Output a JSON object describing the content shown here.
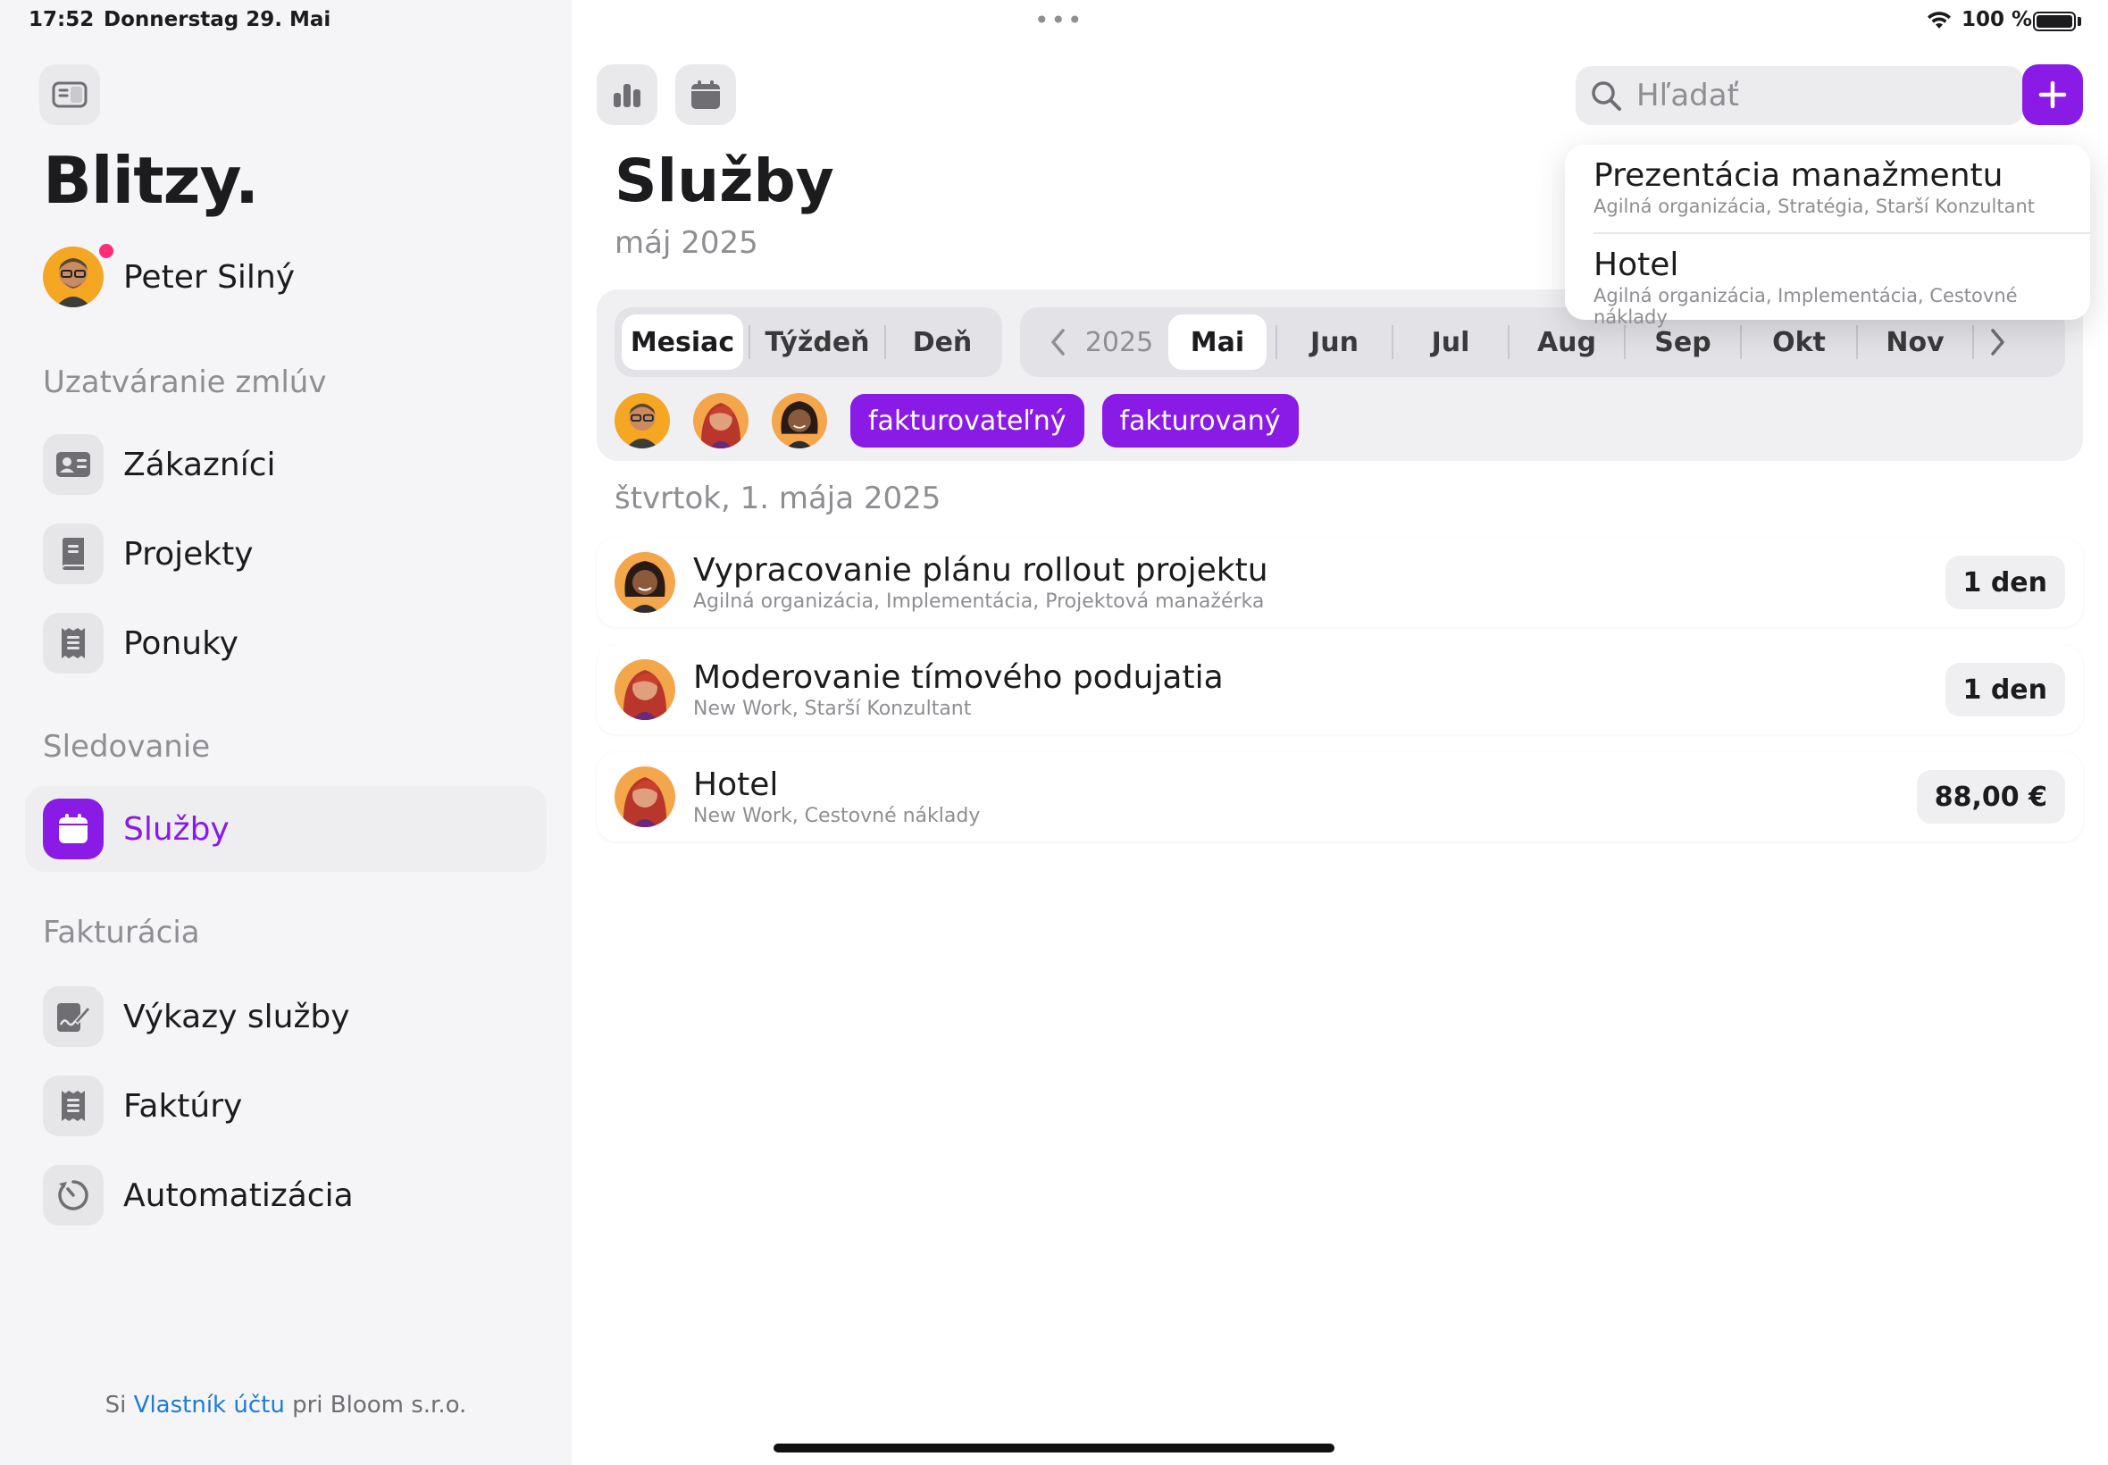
{
  "status_bar": {
    "time": "17:52",
    "date": "Donnerstag 29. Mai",
    "battery": "100 %"
  },
  "sidebar": {
    "brand": "Blitzy.",
    "user_name": "Peter Silný",
    "sections": [
      {
        "title": "Uzatváranie zmlúv",
        "items": [
          {
            "label": "Zákazníci",
            "icon": "contact-card-icon"
          },
          {
            "label": "Projekty",
            "icon": "book-icon"
          },
          {
            "label": "Ponuky",
            "icon": "document-icon"
          }
        ]
      },
      {
        "title": "Sledovanie",
        "items": [
          {
            "label": "Služby",
            "icon": "calendar-icon",
            "active": true
          }
        ]
      },
      {
        "title": "Fakturácia",
        "items": [
          {
            "label": "Výkazy služby",
            "icon": "signed-doc-icon"
          },
          {
            "label": "Faktúry",
            "icon": "receipt-icon"
          },
          {
            "label": "Automatizácia",
            "icon": "automation-icon"
          }
        ]
      }
    ],
    "footer": {
      "prefix": "Si ",
      "link": "Vlastník účtu",
      "suffix": " pri Bloom s.r.o."
    }
  },
  "toolbar": {
    "search_placeholder": "Hľadať"
  },
  "page": {
    "title": "Služby",
    "subtitle": "máj 2025"
  },
  "filters": {
    "segments": [
      "Mesiac",
      "Týždeň",
      "Deň"
    ],
    "selected_segment": "Mesiac",
    "year": "2025",
    "months": [
      "Mai",
      "Jun",
      "Jul",
      "Aug",
      "Sep",
      "Okt",
      "Nov"
    ],
    "selected_month": "Mai",
    "tags": [
      "fakturovateľný",
      "fakturovaný"
    ]
  },
  "date_header": "štvrtok, 1. mája 2025",
  "entries": [
    {
      "title": "Vypracovanie plánu rollout projektu",
      "subtitle": "Agilná organizácia, Implementácia, Projektová manažérka",
      "value": "1 den"
    },
    {
      "title": "Moderovanie tímového podujatia",
      "subtitle": "New Work, Starší Konzultant",
      "value": "1 den"
    },
    {
      "title": "Hotel",
      "subtitle": "New Work, Cestovné náklady",
      "value": "88,00 €"
    }
  ],
  "dropdown": [
    {
      "title": "Prezentácia manažmentu",
      "subtitle": "Agilná organizácia, Stratégia, Starší Konzultant"
    },
    {
      "title": "Hotel",
      "subtitle": "Agilná organizácia, Implementácia, Cestovné náklady"
    }
  ],
  "colors": {
    "accent": "#8a1ae6",
    "link": "#1f7ad6",
    "notification": "#ff2d78"
  }
}
